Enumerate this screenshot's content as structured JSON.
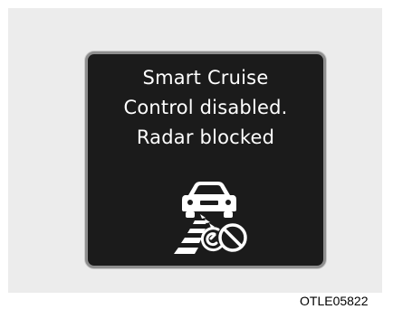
{
  "display": {
    "lines": [
      "Smart Cruise",
      "Control disabled.",
      "Radar blocked"
    ],
    "icon": "radar-blocked-icon"
  },
  "caption": "OTLE05822"
}
